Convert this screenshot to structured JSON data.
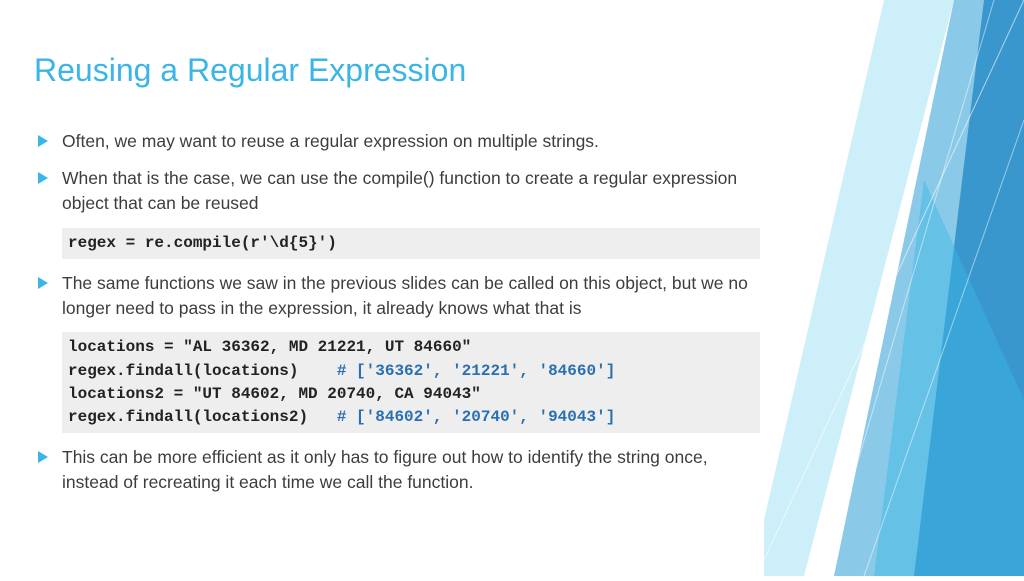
{
  "title": "Reusing a Regular Expression",
  "bullets": {
    "b1": "Often, we may want to reuse a regular expression on multiple strings.",
    "b2": "When that is the case, we can use the compile() function to create a regular expression object that can be reused",
    "b3": "The same functions we saw in the previous slides can be called on this object, but we no longer need to pass in the expression, it already knows what that is",
    "b4": "This can be more efficient as it only has to figure out how to identify the string once, instead of recreating it each time we call the function."
  },
  "code1": "regex = re.compile(r'\\d{5}')",
  "code2": {
    "l1a": "locations = \"AL 36362, MD 21221, UT 84660\"",
    "l2a": "regex.findall(locations)    ",
    "l2b": "# ['36362', '21221', '84660']",
    "l3a": "locations2 = \"UT 84602, MD 20740, CA 94043\"",
    "l4a": "regex.findall(locations2)   ",
    "l4b": "# ['84602', '20740', '94043']"
  }
}
